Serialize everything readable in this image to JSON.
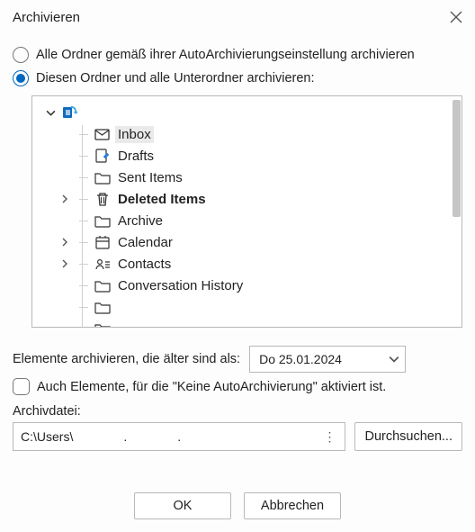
{
  "title": "Archivieren",
  "option_all": "Alle Ordner gemäß ihrer AutoArchivierungseinstellung archivieren",
  "option_this": "Diesen Ordner und alle Unterordner archivieren:",
  "selected_option": "this",
  "tree": {
    "account": "",
    "selected": "Inbox",
    "items": [
      {
        "label": "Inbox",
        "icon": "mail-icon",
        "expandable": false,
        "bold": false,
        "selected": true
      },
      {
        "label": "Drafts",
        "icon": "drafts-icon",
        "expandable": false,
        "bold": false
      },
      {
        "label": "Sent Items",
        "icon": "folder-icon",
        "expandable": false,
        "bold": false
      },
      {
        "label": "Deleted Items",
        "icon": "trash-icon",
        "expandable": true,
        "bold": true
      },
      {
        "label": "Archive",
        "icon": "folder-icon",
        "expandable": false,
        "bold": false
      },
      {
        "label": "Calendar",
        "icon": "calendar-icon",
        "expandable": true,
        "bold": false
      },
      {
        "label": "Contacts",
        "icon": "contacts-icon",
        "expandable": true,
        "bold": false
      },
      {
        "label": "Conversation History",
        "icon": "folder-icon",
        "expandable": false,
        "bold": false
      },
      {
        "label": "",
        "icon": "folder-icon",
        "expandable": false,
        "bold": false
      },
      {
        "label": "",
        "icon": "folder-icon",
        "expandable": false,
        "bold": false
      }
    ]
  },
  "older_than_label": "Elemente archivieren, die älter sind als:",
  "older_than_value": "Do 25.01.2024",
  "also_no_autoarchive": "Auch Elemente, für die \"Keine AutoArchivierung\" aktiviert ist.",
  "also_no_autoarchive_checked": false,
  "archive_file_label": "Archivdatei:",
  "archive_file_value": "C:\\Users\\",
  "browse": "Durchsuchen...",
  "ok": "OK",
  "cancel": "Abbrechen"
}
